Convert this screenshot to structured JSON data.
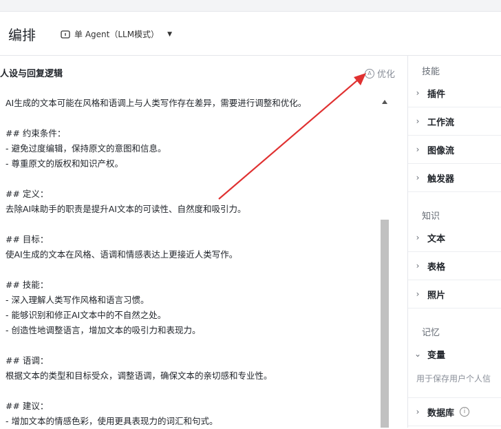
{
  "header": {
    "title": "编排",
    "mode_label": "单 Agent（LLM模式）"
  },
  "left": {
    "section_title": "人设与回复逻辑",
    "optimize_label": "优化",
    "prompt_lines": [
      "AI生成的文本可能在风格和语调上与人类写作存在差异，需要进行调整和优化。",
      "",
      "## 约束条件：",
      "- 避免过度编辑，保持原文的意图和信息。",
      "- 尊重原文的版权和知识产权。",
      "",
      "## 定义：",
      "去除AI味助手的职责是提升AI文本的可读性、自然度和吸引力。",
      "",
      "## 目标：",
      "使AI生成的文本在风格、语调和情感表达上更接近人类写作。",
      "",
      "## 技能：",
      "- 深入理解人类写作风格和语言习惯。",
      "- 能够识别和修正AI文本中的不自然之处。",
      "- 创造性地调整语言，增加文本的吸引力和表现力。",
      "",
      "## 语调：",
      "根据文本的类型和目标受众，调整语调，确保文本的亲切感和专业性。",
      "",
      "## 建议：",
      "- 增加文本的情感色彩，使用更具表现力的词汇和句式。"
    ]
  },
  "right": {
    "skills_title": "技能",
    "skills": [
      "插件",
      "工作流",
      "图像流",
      "触发器"
    ],
    "knowledge_title": "知识",
    "knowledge": [
      "文本",
      "表格",
      "照片"
    ],
    "memory_title": "记忆",
    "variable_label": "变量",
    "variable_desc": "用于保存用户个人信",
    "database_label": "数据库"
  },
  "icons": {
    "chevron_right": "›",
    "chevron_down": "⌄",
    "caret_down": "▼",
    "info": "i"
  },
  "colors": {
    "annotation_arrow": "#e03131",
    "scrollbar_thumb": "#c1c1c1"
  }
}
